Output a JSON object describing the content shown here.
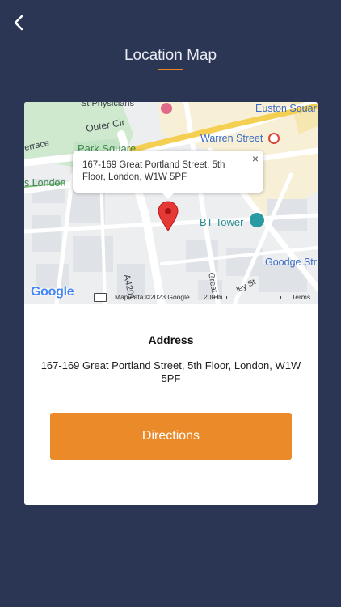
{
  "header": {
    "title": "Location Map"
  },
  "map": {
    "labels": {
      "euston_square": "Euston Squar",
      "outer_circle": "Outer Cir",
      "errace": "errace",
      "park_square": "Park Square",
      "warren_street": "Warren Street",
      "london": "s London",
      "bt_tower": "BT Tower",
      "goodge_street": "Goodge Str",
      "a4201": "A4201",
      "great_titchfield": "Great T",
      "riley_st": "ley St",
      "st_physicians": "St Physicians"
    },
    "popup": {
      "address": "167-169 Great Portland Street, 5th Floor, London, W1W 5PF",
      "close_symbol": "×"
    },
    "attribution": {
      "logo": "Google",
      "map_data": "Map data ©2023 Google",
      "scale": "200 m",
      "terms": "Terms"
    }
  },
  "details": {
    "address_heading": "Address",
    "address": "167-169 Great Portland Street, 5th Floor, London, W1W 5PF",
    "directions_label": "Directions"
  },
  "colors": {
    "background": "#2b3655",
    "accent": "#ea8a28",
    "card": "#ffffff"
  }
}
